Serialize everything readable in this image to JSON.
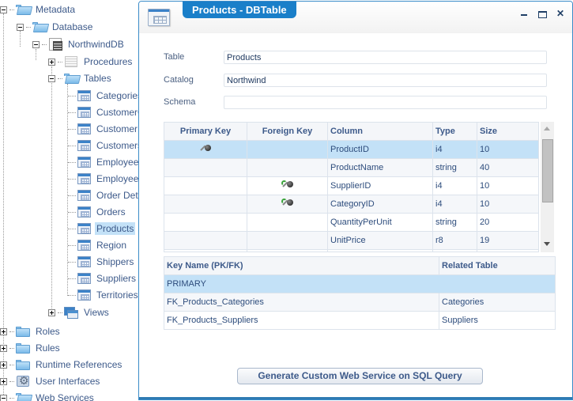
{
  "tree": {
    "metadata": "Metadata",
    "database": "Database",
    "northwind_db": "NorthwindDB",
    "procedures": "Procedures",
    "tables": "Tables",
    "table_items": [
      "Categories",
      "CustomerC",
      "CustomerD",
      "Customers",
      "Employees",
      "EmployeeTe",
      "Order Detai",
      "Orders",
      "Products",
      "Region",
      "Shippers",
      "Suppliers",
      "Territories"
    ],
    "selected_table": "Products",
    "views": "Views",
    "roles": "Roles",
    "rules": "Rules",
    "runtime_references": "Runtime References",
    "user_interfaces": "User Interfaces",
    "web_services": "Web Services"
  },
  "dialog": {
    "title": "Products - DBTable",
    "window_buttons": {
      "minimize": "minimize",
      "maximize": "maximize",
      "close": "✕"
    },
    "fields": {
      "table_label": "Table",
      "table_value": "Products",
      "catalog_label": "Catalog",
      "catalog_value": "Northwind",
      "schema_label": "Schema",
      "schema_value": ""
    },
    "columns_grid": {
      "headers": [
        "Primary Key",
        "Foreign Key",
        "Column",
        "Type",
        "Size"
      ],
      "rows": [
        {
          "pk": true,
          "fk": false,
          "column": "ProductID",
          "type": "i4",
          "size": "10"
        },
        {
          "pk": false,
          "fk": false,
          "column": "ProductName",
          "type": "string",
          "size": "40"
        },
        {
          "pk": false,
          "fk": true,
          "column": "SupplierID",
          "type": "i4",
          "size": "10"
        },
        {
          "pk": false,
          "fk": true,
          "column": "CategoryID",
          "type": "i4",
          "size": "10"
        },
        {
          "pk": false,
          "fk": false,
          "column": "QuantityPerUnit",
          "type": "string",
          "size": "20"
        },
        {
          "pk": false,
          "fk": false,
          "column": "UnitPrice",
          "type": "r8",
          "size": "19"
        }
      ],
      "selected_row": 0
    },
    "keys_grid": {
      "headers": [
        "Key Name (PK/FK)",
        "Related Table"
      ],
      "rows": [
        {
          "key": "PRIMARY",
          "related": ""
        },
        {
          "key": "FK_Products_Categories",
          "related": "Categories"
        },
        {
          "key": "FK_Products_Suppliers",
          "related": "Suppliers"
        }
      ],
      "selected_row": 0
    },
    "generate_button": "Generate Custom Web Service on SQL Query"
  },
  "colors": {
    "accent": "#1a7fc9",
    "selection": "#c3e1f7",
    "text": "#2d4c7c"
  }
}
